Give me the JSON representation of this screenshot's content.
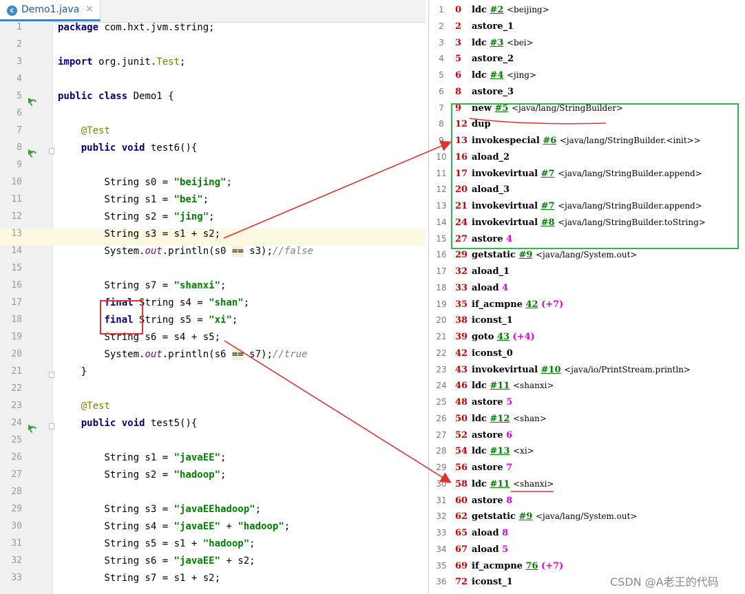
{
  "tab": {
    "icon": "java-class-icon",
    "label": "Demo1.java",
    "close": "×"
  },
  "code_lines": [
    {
      "n": "1",
      "html": "<span class=\"kw\">package</span> com.hxt.jvm.string;"
    },
    {
      "n": "2",
      "html": ""
    },
    {
      "n": "3",
      "html": "<span class=\"kw\">import</span> org.junit.<span class=\"cls\">Test</span>;"
    },
    {
      "n": "4",
      "html": ""
    },
    {
      "n": "5",
      "html": "<span class=\"kw\">public class</span> Demo1 {",
      "run": true
    },
    {
      "n": "6",
      "html": ""
    },
    {
      "n": "7",
      "html": "    <span class=\"ann\">@Test</span>"
    },
    {
      "n": "8",
      "html": "    <span class=\"kw\">public void</span> test6(){",
      "run": true,
      "fold": true
    },
    {
      "n": "9",
      "html": ""
    },
    {
      "n": "10",
      "html": "        String s0 = <span class=\"str\">\"beijing\"</span>;"
    },
    {
      "n": "11",
      "html": "        String s1 = <span class=\"str\">\"bei\"</span>;"
    },
    {
      "n": "12",
      "html": "        String s2 = <span class=\"str\">\"jing\"</span>;"
    },
    {
      "n": "13",
      "html": "        String s3 = s1 + s2;"
    },
    {
      "n": "14",
      "html": "        System.<span class=\"fld\">out</span>.println(s0 <span class=\"hlv\">==</span> s3);<span class=\"cmt\">//false</span>"
    },
    {
      "n": "15",
      "html": ""
    },
    {
      "n": "16",
      "html": "        String s7 = <span class=\"str\">\"shanxi\"</span>;"
    },
    {
      "n": "17",
      "html": "        <span class=\"kw\">final</span> String s4 = <span class=\"str\">\"shan\"</span>;"
    },
    {
      "n": "18",
      "html": "        <span class=\"kw\">final</span> String s5 = <span class=\"str\">\"xi\"</span>;"
    },
    {
      "n": "19",
      "html": "        String s6 = s4 + s5;"
    },
    {
      "n": "20",
      "html": "        System.<span class=\"fld\">out</span>.println(s6 <span class=\"hlv\">==</span> s7);<span class=\"cmt\">//true</span>"
    },
    {
      "n": "21",
      "html": "    }",
      "fold": true
    },
    {
      "n": "22",
      "html": ""
    },
    {
      "n": "23",
      "html": "    <span class=\"ann\">@Test</span>"
    },
    {
      "n": "24",
      "html": "    <span class=\"kw\">public void</span> test5(){",
      "run": true,
      "fold": true
    },
    {
      "n": "25",
      "html": ""
    },
    {
      "n": "26",
      "html": "        String s1 = <span class=\"str\">\"javaEE\"</span>;"
    },
    {
      "n": "27",
      "html": "        String s2 = <span class=\"str\">\"hadoop\"</span>;"
    },
    {
      "n": "28",
      "html": ""
    },
    {
      "n": "29",
      "html": "        String s3 = <span class=\"str\">\"javaEEhadoop\"</span>;"
    },
    {
      "n": "30",
      "html": "        String s4 = <span class=\"str\">\"javaEE\"</span> + <span class=\"str\">\"hadoop\"</span>;"
    },
    {
      "n": "31",
      "html": "        String s5 = s1 + <span class=\"str\">\"hadoop\"</span>;"
    },
    {
      "n": "32",
      "html": "        String s6 = <span class=\"str\">\"javaEE\"</span> + s2;"
    },
    {
      "n": "33",
      "html": "        String s7 = s1 + s2;"
    }
  ],
  "bytecode": [
    {
      "n": "1",
      "off": "0",
      "op": "ldc",
      "arg": "#2",
      "cmt": "<beijing>"
    },
    {
      "n": "2",
      "off": "2",
      "op": "astore_1"
    },
    {
      "n": "3",
      "off": "3",
      "op": "ldc",
      "arg": "#3",
      "cmt": "<bei>"
    },
    {
      "n": "4",
      "off": "5",
      "op": "astore_2"
    },
    {
      "n": "5",
      "off": "6",
      "op": "ldc",
      "arg": "#4",
      "cmt": "<jing>"
    },
    {
      "n": "6",
      "off": "8",
      "op": "astore_3"
    },
    {
      "n": "7",
      "off": "9",
      "op": "new",
      "arg": "#5",
      "cmt": "<java/lang/StringBuilder>"
    },
    {
      "n": "8",
      "off": "12",
      "op": "dup"
    },
    {
      "n": "9",
      "off": "13",
      "op": "invokespecial",
      "arg": "#6",
      "cmt": "<java/lang/StringBuilder.<init>>"
    },
    {
      "n": "10",
      "off": "16",
      "op": "aload_2"
    },
    {
      "n": "11",
      "off": "17",
      "op": "invokevirtual",
      "arg": "#7",
      "cmt": "<java/lang/StringBuilder.append>"
    },
    {
      "n": "12",
      "off": "20",
      "op": "aload_3"
    },
    {
      "n": "13",
      "off": "21",
      "op": "invokevirtual",
      "arg": "#7",
      "cmt": "<java/lang/StringBuilder.append>"
    },
    {
      "n": "14",
      "off": "24",
      "op": "invokevirtual",
      "arg": "#8",
      "cmt": "<java/lang/StringBuilder.toString>"
    },
    {
      "n": "15",
      "off": "27",
      "op": "astore",
      "mag": "4"
    },
    {
      "n": "16",
      "off": "29",
      "op": "getstatic",
      "arg": "#9",
      "cmt": "<java/lang/System.out>"
    },
    {
      "n": "17",
      "off": "32",
      "op": "aload_1"
    },
    {
      "n": "18",
      "off": "33",
      "op": "aload",
      "mag": "4"
    },
    {
      "n": "19",
      "off": "35",
      "op": "if_acmpne",
      "arg": "42",
      "mag": "(+7)"
    },
    {
      "n": "20",
      "off": "38",
      "op": "iconst_1"
    },
    {
      "n": "21",
      "off": "39",
      "op": "goto",
      "arg": "43",
      "mag": "(+4)"
    },
    {
      "n": "22",
      "off": "42",
      "op": "iconst_0"
    },
    {
      "n": "23",
      "off": "43",
      "op": "invokevirtual",
      "arg": "#10",
      "cmt": "<java/io/PrintStream.println>"
    },
    {
      "n": "24",
      "off": "46",
      "op": "ldc",
      "arg": "#11",
      "cmt": "<shanxi>"
    },
    {
      "n": "25",
      "off": "48",
      "op": "astore",
      "mag": "5"
    },
    {
      "n": "26",
      "off": "50",
      "op": "ldc",
      "arg": "#12",
      "cmt": "<shan>"
    },
    {
      "n": "27",
      "off": "52",
      "op": "astore",
      "mag": "6"
    },
    {
      "n": "28",
      "off": "54",
      "op": "ldc",
      "arg": "#13",
      "cmt": "<xi>"
    },
    {
      "n": "29",
      "off": "56",
      "op": "astore",
      "mag": "7"
    },
    {
      "n": "30",
      "off": "58",
      "op": "ldc",
      "arg": "#11",
      "cmt": "<shanxi>"
    },
    {
      "n": "31",
      "off": "60",
      "op": "astore",
      "mag": "8"
    },
    {
      "n": "32",
      "off": "62",
      "op": "getstatic",
      "arg": "#9",
      "cmt": "<java/lang/System.out>"
    },
    {
      "n": "33",
      "off": "65",
      "op": "aload",
      "mag": "8"
    },
    {
      "n": "34",
      "off": "67",
      "op": "aload",
      "mag": "5"
    },
    {
      "n": "35",
      "off": "69",
      "op": "if_acmpne",
      "arg": "76",
      "mag": "(+7)"
    },
    {
      "n": "36",
      "off": "72",
      "op": "iconst_1"
    }
  ],
  "watermark": "CSDN @A老王的代码",
  "colors": {
    "annotation_red": "#e53030",
    "box_green": "#2db84c"
  }
}
